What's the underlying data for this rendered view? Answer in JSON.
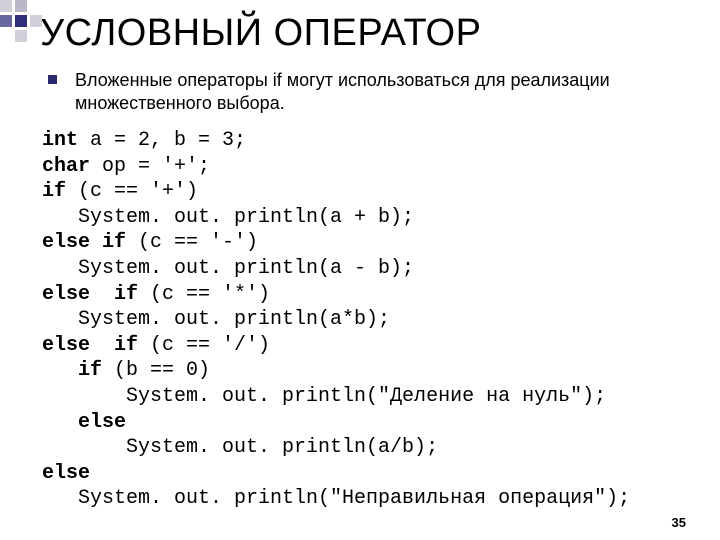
{
  "decoration": {
    "navy": "#303078",
    "gray_dark": "#6868a0",
    "gray_mid": "#b8b8c8",
    "gray_light": "#d0d0d8"
  },
  "title": "УСЛОВНЫЙ ОПЕРАТОР",
  "bullet_text": "Вложенные операторы if могут использоваться для реализации множественного выбора.",
  "code": {
    "l01a": "int",
    "l01b": " a = 2, b = 3;",
    "l02a": "char",
    "l02b": " op = '+';",
    "l03a": "if",
    "l03b": " (c == '+')",
    "l04": "   System. out. println(a + b);",
    "l05a": "else if",
    "l05b": " (c == '-')",
    "l06": "   System. out. println(a - b);",
    "l07a": "else  if",
    "l07b": " (c == '*')",
    "l08": "   System. out. println(a*b);",
    "l09a": "else  if",
    "l09b": " (c == '/')",
    "l10a": "   if",
    "l10b": " (b == 0)",
    "l11": "       System. out. println(\"Деление на нуль\");",
    "l12a": "   else",
    "l13": "       System. out. println(a/b);",
    "l14a": "else",
    "l15": "   System. out. println(\"Неправильная операция\");"
  },
  "page_number": "35"
}
